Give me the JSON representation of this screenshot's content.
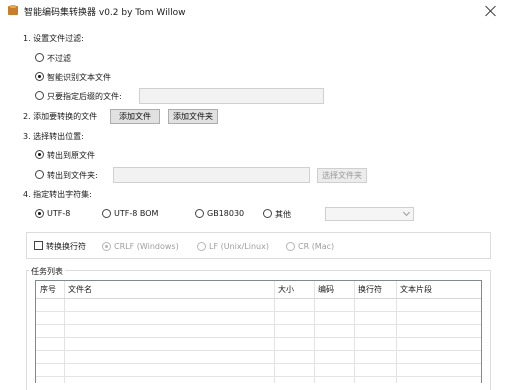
{
  "window": {
    "title": "智能编码集转换器 v0.2 by Tom Willow",
    "icon": "app-icon"
  },
  "filter": {
    "heading": "1. 设置文件过滤:",
    "options": [
      "不过滤",
      "智能识别文本文件",
      "只要指定后缀的文件:"
    ],
    "selected": 1,
    "suffix_value": ""
  },
  "add": {
    "label": "2. 添加要转换的文件",
    "add_file_button": "添加文件",
    "add_folder_button": "添加文件夹"
  },
  "output": {
    "heading": "3. 选择转出位置:",
    "options": [
      "转出到原文件",
      "转出到文件夹:"
    ],
    "selected": 0,
    "folder_value": "",
    "choose_folder_button": "选择文件夹"
  },
  "charset": {
    "heading": "4. 指定转出字符集:",
    "options": [
      "UTF-8",
      "UTF-8 BOM",
      "GB18030",
      "其他"
    ],
    "selected": 0,
    "other_value": ""
  },
  "newline": {
    "checkbox_label": "转换换行符",
    "checked": false,
    "options": [
      "CRLF (Windows)",
      "LF (Unix/Linux)",
      "CR (Mac)"
    ],
    "selected": 0
  },
  "tasks": {
    "heading": "任务列表",
    "columns": [
      "序号",
      "文件名",
      "大小",
      "编码",
      "换行符",
      "文本片段"
    ],
    "rows": []
  }
}
